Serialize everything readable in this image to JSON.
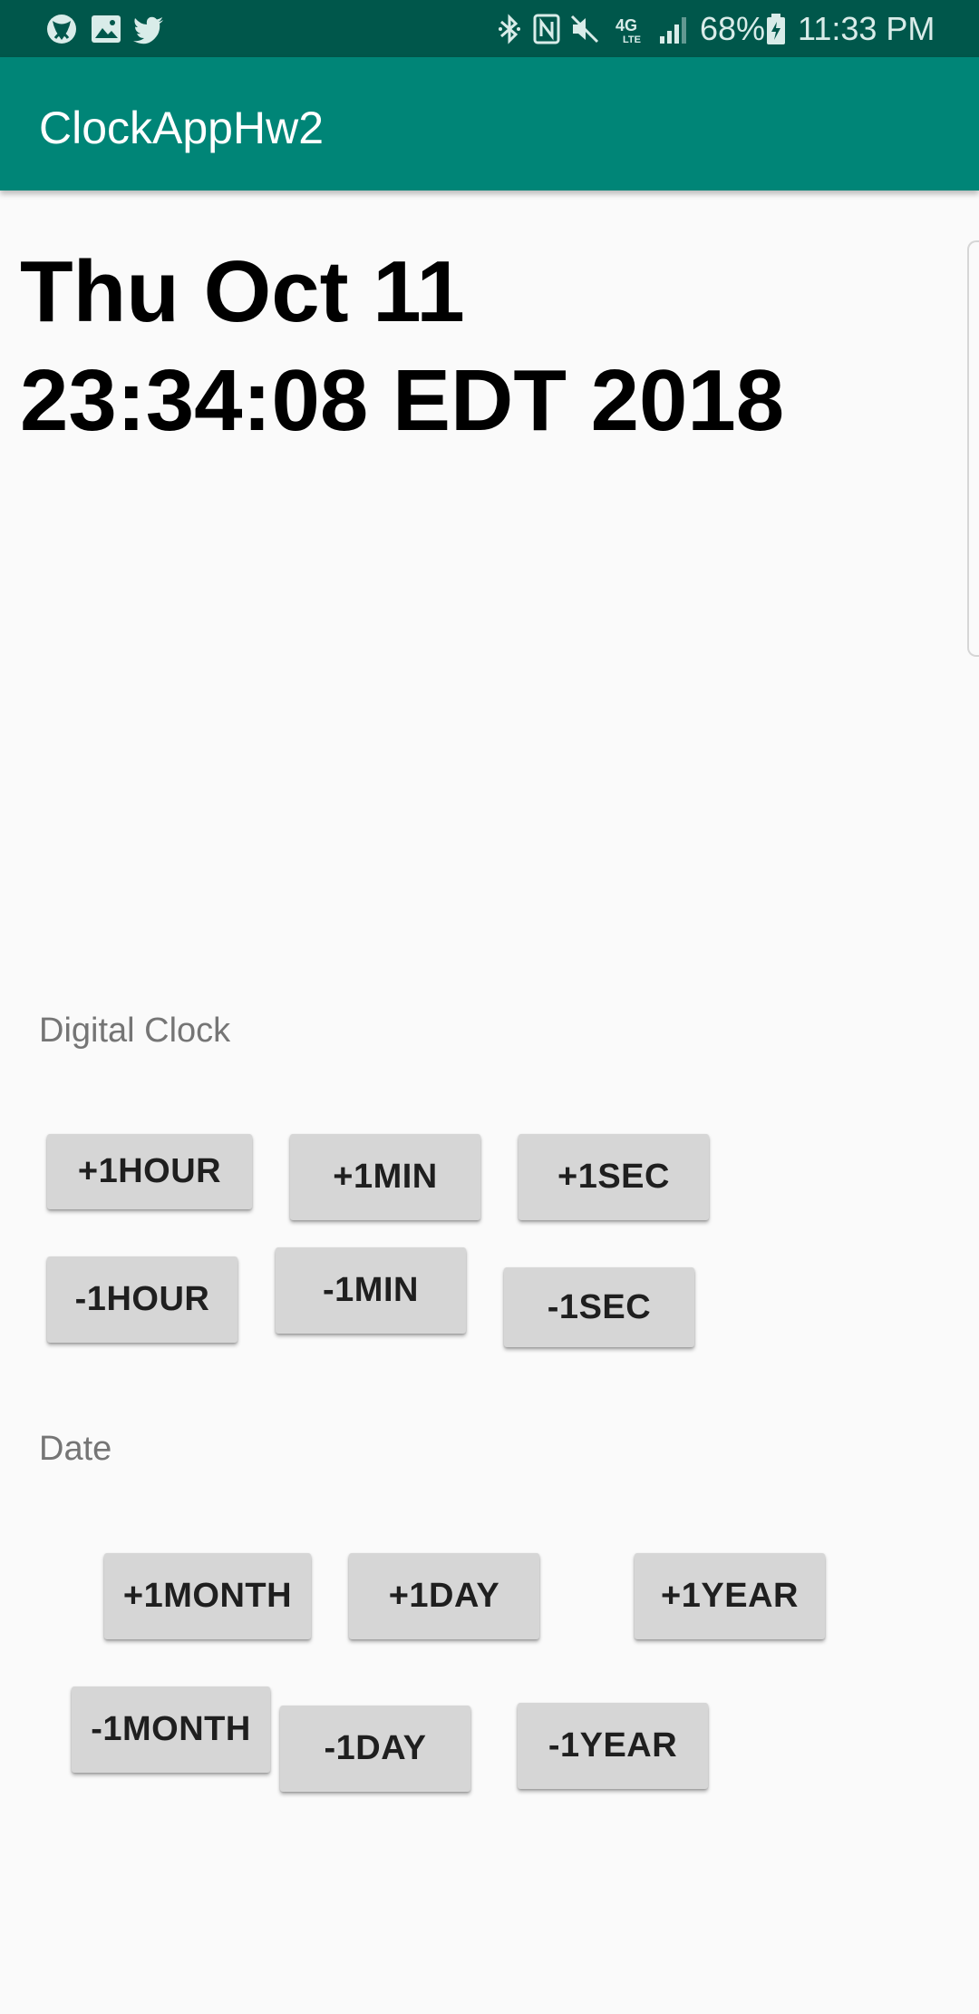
{
  "status_bar": {
    "left_icons": [
      "xbox-icon",
      "image-icon",
      "twitter-icon"
    ],
    "right_icons": [
      "bluetooth-icon",
      "nfc-icon",
      "mute-icon",
      "4g-lte-icon",
      "signal-icon",
      "battery-icon"
    ],
    "battery_percent": "68%",
    "time": "11:33 PM"
  },
  "app_bar": {
    "title": "ClockAppHw2",
    "color": "#008577"
  },
  "clock": {
    "line1": "Thu Oct 11",
    "line2": "23:34:08 EDT 2018"
  },
  "digital_clock": {
    "label": "Digital Clock",
    "buttons": {
      "plus_hour": "+1HOUR",
      "plus_min": "+1MIN",
      "plus_sec": "+1SEC",
      "minus_hour": "-1HOUR",
      "minus_min": "-1MIN",
      "minus_sec": "-1SEC"
    }
  },
  "date": {
    "label": "Date",
    "buttons": {
      "plus_month": "+1MONTH",
      "plus_day": "+1DAY",
      "plus_year": "+1YEAR",
      "minus_month": "-1MONTH",
      "minus_day": "-1DAY",
      "minus_year": "-1YEAR"
    }
  }
}
